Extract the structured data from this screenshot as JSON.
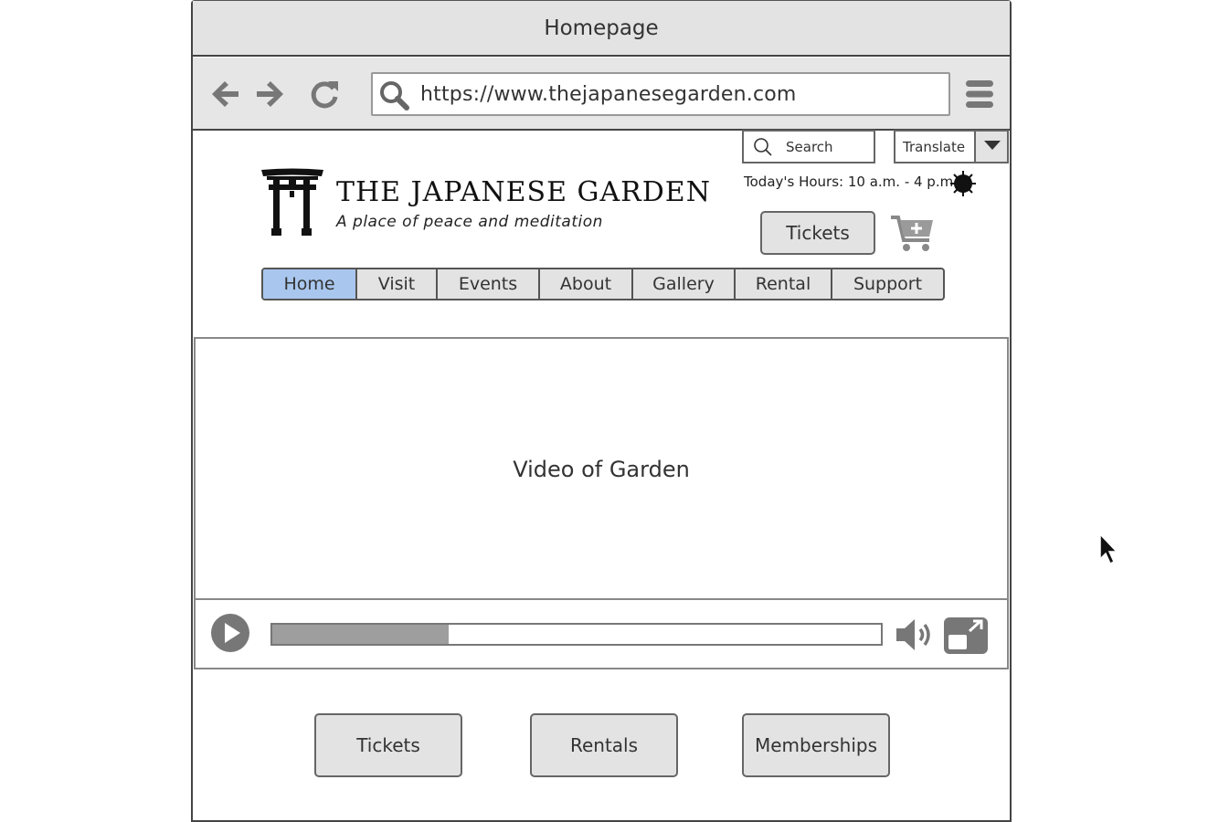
{
  "window": {
    "title": "Homepage"
  },
  "browser": {
    "url": "https://www.thejapanesegarden.com"
  },
  "header": {
    "search_label": "Search",
    "translate_label": "Translate",
    "hours": "Today's Hours: 10 a.m. - 4 p.m.",
    "logo_title": "THE JAPANESE GARDEN",
    "logo_tagline": "A place of peace and meditation",
    "tickets_label": "Tickets"
  },
  "nav": {
    "items": [
      {
        "label": "Home",
        "active": true
      },
      {
        "label": "Visit"
      },
      {
        "label": "Events"
      },
      {
        "label": "About"
      },
      {
        "label": "Gallery"
      },
      {
        "label": "Rental"
      },
      {
        "label": "Support"
      }
    ]
  },
  "video": {
    "placeholder": "Video of Garden",
    "progress": 0.29
  },
  "actions": {
    "tickets": "Tickets",
    "rentals": "Rentals",
    "memberships": "Memberships"
  },
  "colors": {
    "active_tab": "#a9c7ee",
    "chrome": "#e3e3e3",
    "icon_gray": "#777777"
  },
  "icons": [
    "back-arrow-icon",
    "forward-arrow-icon",
    "reload-icon",
    "search-icon",
    "hamburger-menu-icon",
    "chevron-down-icon",
    "sun-icon",
    "add-to-cart-icon",
    "torii-gate-icon",
    "play-icon",
    "volume-icon",
    "fullscreen-icon",
    "mouse-cursor-icon"
  ]
}
